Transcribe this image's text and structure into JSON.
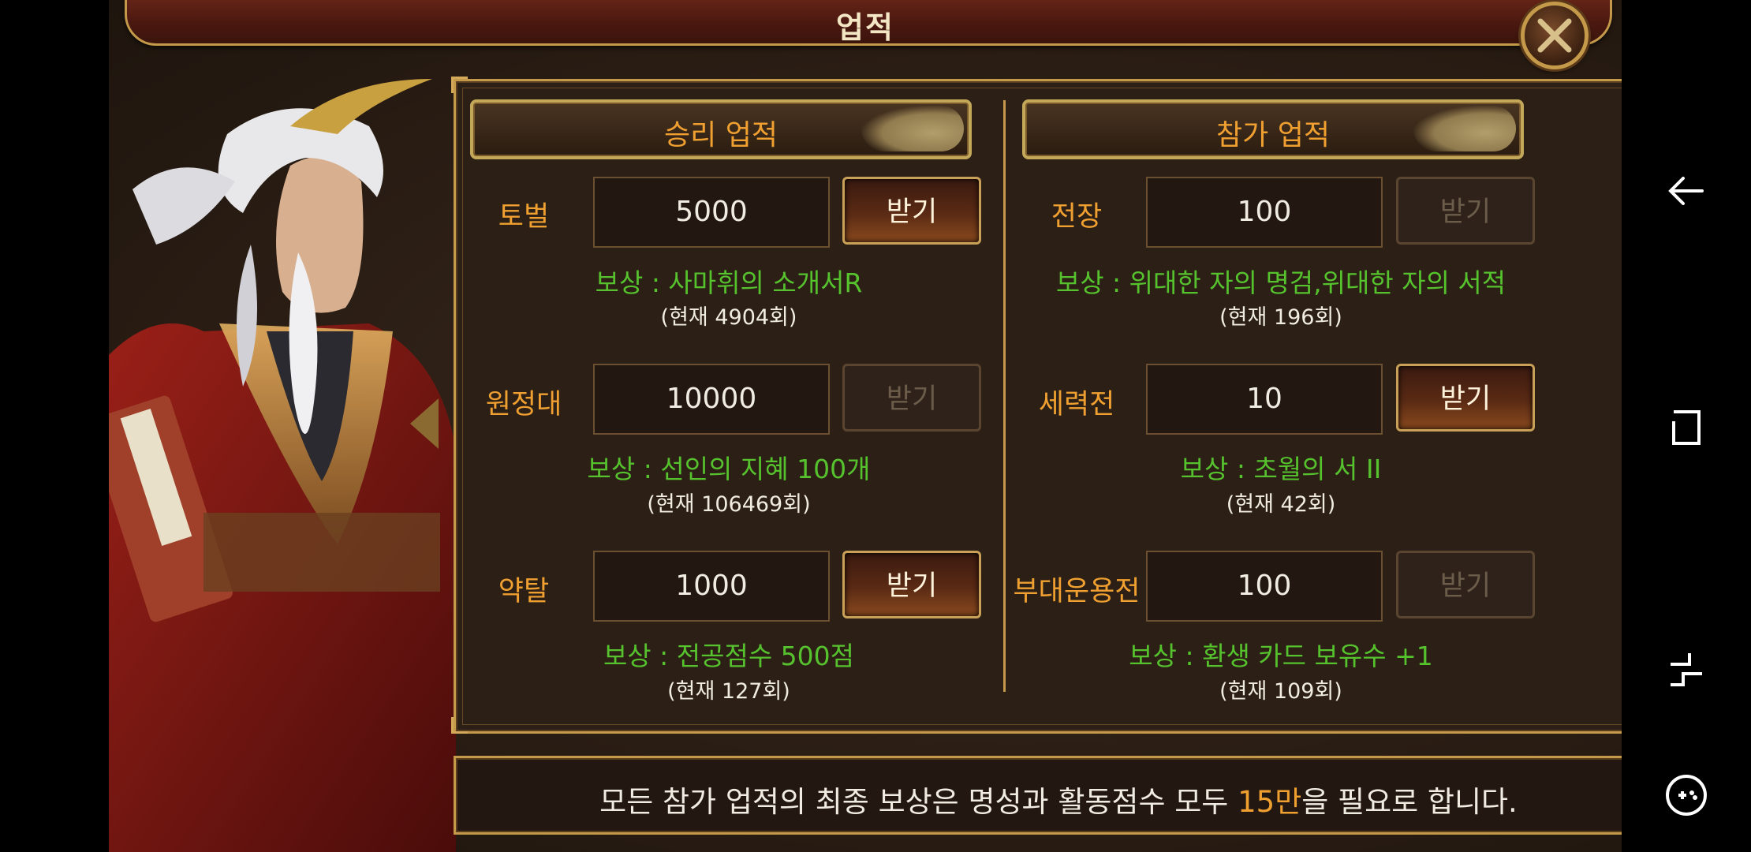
{
  "title": "업적",
  "colors": {
    "accent_orange": "#f0a030",
    "reward_green": "#55c22e",
    "gold_border": "#c49a4a"
  },
  "victory": {
    "header": "승리 업적",
    "rows": [
      {
        "label": "토벌",
        "value": "5000",
        "button": "받기",
        "enabled": true,
        "reward": "보상 : 사마휘의 소개서R",
        "count": "(현재 4904회)"
      },
      {
        "label": "원정대",
        "value": "10000",
        "button": "받기",
        "enabled": false,
        "reward": "보상 : 선인의 지혜 100개",
        "count": "(현재 106469회)"
      },
      {
        "label": "약탈",
        "value": "1000",
        "button": "받기",
        "enabled": true,
        "reward": "보상 : 전공점수 500점",
        "count": "(현재 127회)"
      }
    ]
  },
  "participation": {
    "header": "참가 업적",
    "rows": [
      {
        "label": "전장",
        "value": "100",
        "button": "받기",
        "enabled": false,
        "reward": "보상 : 위대한 자의 명검,위대한 자의 서적",
        "count": "(현재 196회)"
      },
      {
        "label": "세력전",
        "value": "10",
        "button": "받기",
        "enabled": true,
        "reward": "보상 : 초월의 서 II",
        "count": "(현재 42회)"
      },
      {
        "label": "부대운용전",
        "value": "100",
        "button": "받기",
        "enabled": false,
        "reward": "보상 : 환생 카드 보유수 +1",
        "count": "(현재 109회)"
      }
    ]
  },
  "notice": {
    "before": "모든 참가 업적의 최종 보상은 명성과 활동점수 모두 ",
    "highlight": "15만",
    "after": "을 필요로 합니다."
  },
  "icons": [
    "close-icon",
    "back-arrow-icon",
    "recent-apps-icon",
    "nav-switch-icon",
    "game-tools-icon"
  ]
}
